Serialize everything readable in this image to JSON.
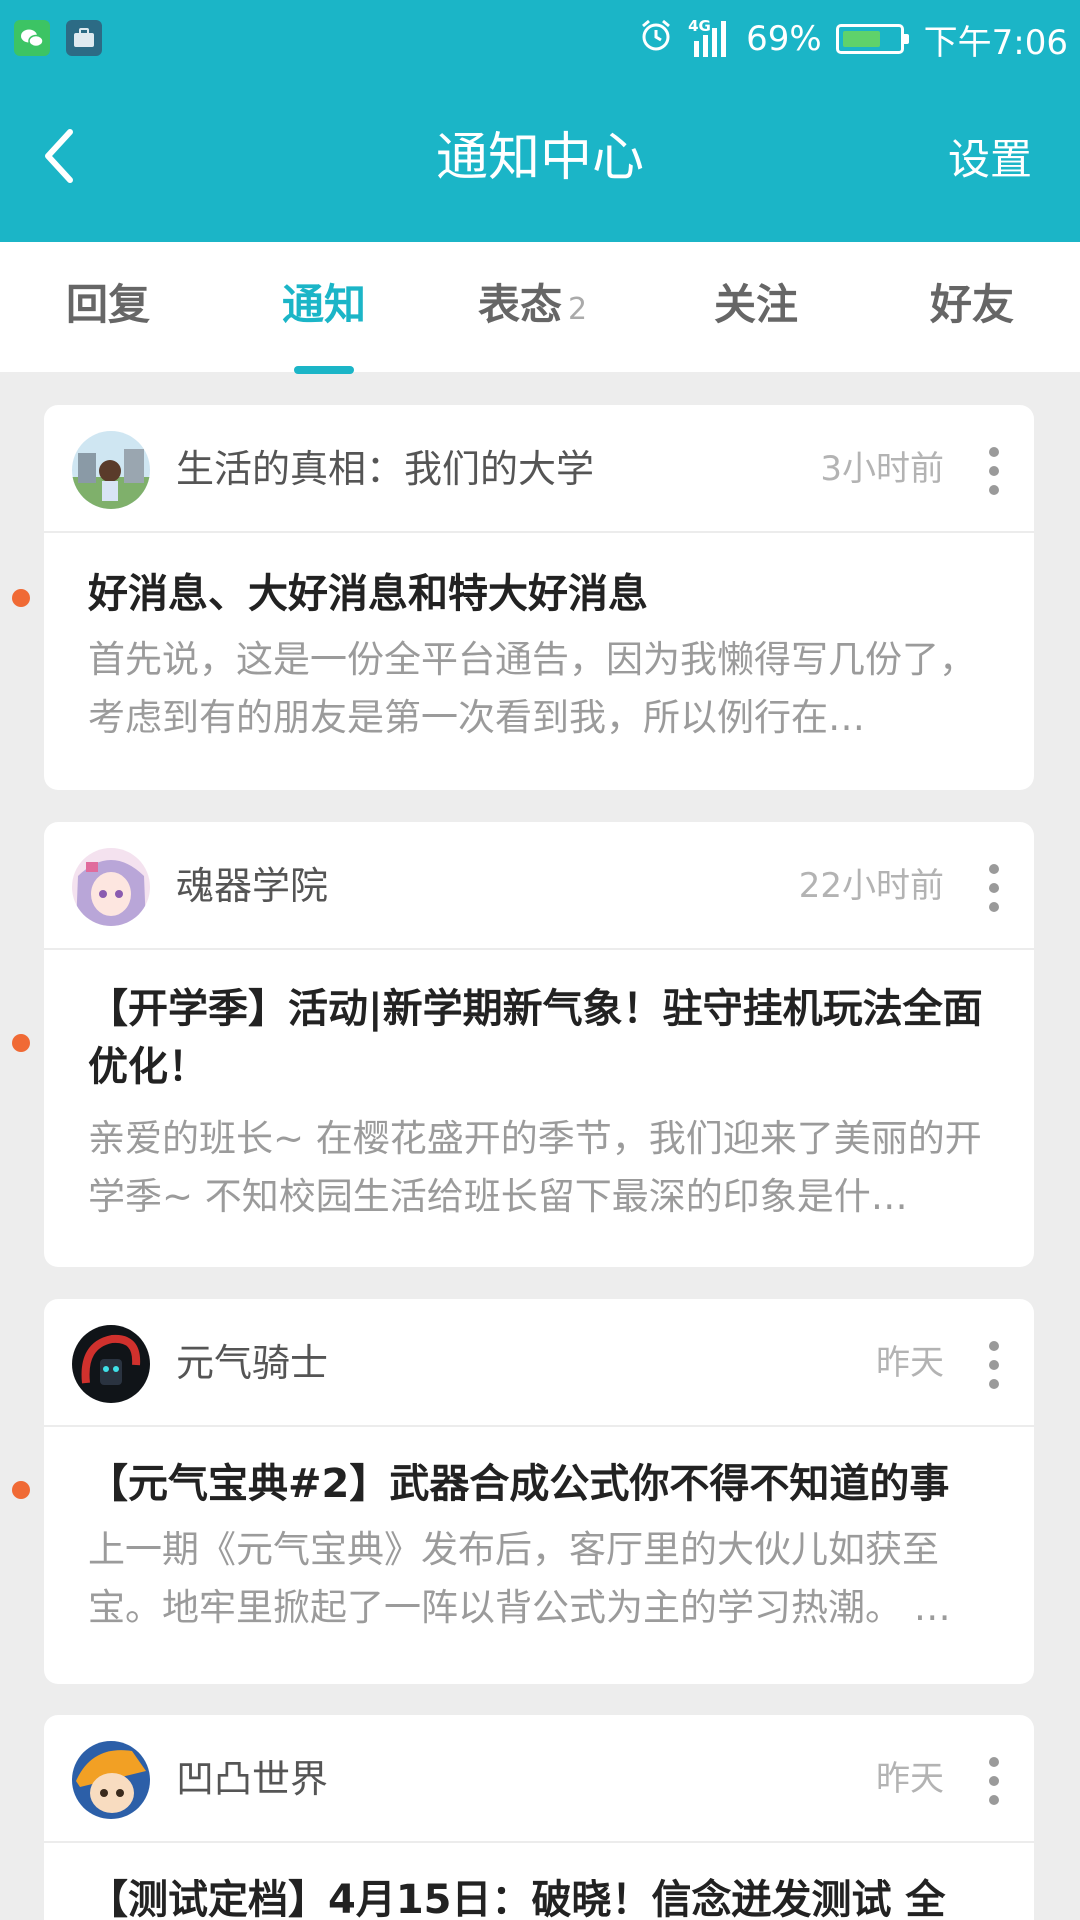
{
  "status_bar": {
    "apps": [
      "wechat-icon",
      "bag-icon"
    ],
    "network": "4G",
    "battery": "69%",
    "battery_level": 0.69,
    "time": "下午7:06"
  },
  "header": {
    "title": "通知中心",
    "settings_label": "设置"
  },
  "tabs": [
    {
      "label": "回复",
      "badge": "",
      "active": false
    },
    {
      "label": "通知",
      "badge": "",
      "active": true
    },
    {
      "label": "表态",
      "badge": "2",
      "active": false
    },
    {
      "label": "关注",
      "badge": "",
      "active": false
    },
    {
      "label": "好友",
      "badge": "",
      "active": false
    }
  ],
  "notifications": [
    {
      "source": "生活的真相：我们的大学",
      "time": "3小时前",
      "unread": true,
      "title": "好消息、大好消息和特大好消息",
      "body": "首先说，这是一份全平台通告，因为我懒得写几份了，考虑到有的朋友是第一次看到我，所以例行在…"
    },
    {
      "source": "魂器学院",
      "time": "22小时前",
      "unread": true,
      "title": "【开学季】活动|新学期新气象！驻守挂机玩法全面优化！",
      "body": "亲爱的班长~ 在樱花盛开的季节，我们迎来了美丽的开学季~ 不知校园生活给班长留下最深的印象是什…"
    },
    {
      "source": "元气骑士",
      "time": "昨天",
      "unread": true,
      "title": "【元气宝典#2】武器合成公式你不得不知道的事",
      "body": "上一期《元气宝典》发布后，客厅里的大伙儿如获至宝。地牢里掀起了一阵以背公式为主的学习热潮。 …"
    },
    {
      "source": "凹凸世界",
      "time": "昨天",
      "unread": false,
      "title": "【测试定档】4月15日：破晓！信念迸发测试 全",
      "body": ""
    }
  ],
  "colors": {
    "accent": "#1bb5c7",
    "unread_dot": "#f06a35"
  }
}
